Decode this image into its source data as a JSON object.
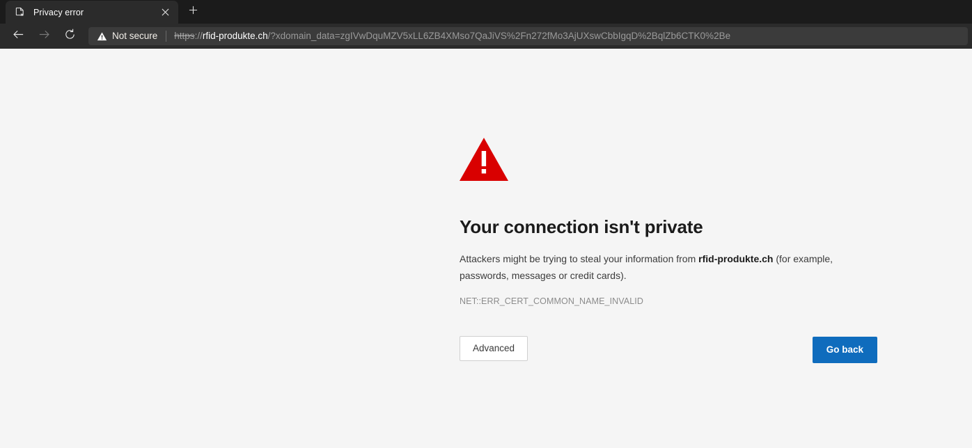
{
  "window": {
    "title": "Privacy error"
  },
  "tabstrip": {
    "tab": {
      "title": "Privacy error",
      "favicon_icon": "broken-page-icon",
      "close_icon": "close-icon"
    },
    "new_tab": {
      "icon": "plus-icon",
      "label": "New tab"
    }
  },
  "toolbar": {
    "back": {
      "icon": "arrow-left-icon",
      "label": "Back",
      "enabled": true
    },
    "forward": {
      "icon": "arrow-right-icon",
      "label": "Forward",
      "enabled": false
    },
    "reload": {
      "icon": "reload-icon",
      "label": "Refresh",
      "enabled": true
    },
    "address": {
      "security_icon": "warning-triangle-icon",
      "security_label": "Not secure",
      "url_scheme": "https",
      "url_scheme_separator": "://",
      "url_host": "rfid-produkte.ch",
      "url_path": "/?xdomain_data=zgIVwDquMZV5xLL6ZB4XMso7QaJiVS%2Fn272fMo3AjUXswCbbIgqD%2BqlZb6CTK0%2Be",
      "full_url": "https://rfid-produkte.ch/?xdomain_data=zgIVwDquMZV5xLL6ZB4XMso7QaJiVS%2Fn272fMo3AjUXswCbbIgqD%2BqlZb6CTK0%2Be"
    }
  },
  "interstitial": {
    "icon": "red-warning-triangle-icon",
    "heading": "Your connection isn't private",
    "body_prefix": "Attackers might be trying to steal your information from ",
    "body_domain": "rfid-produkte.ch",
    "body_suffix": " (for example, passwords, messages or credit cards).",
    "error_code": "NET::ERR_CERT_COMMON_NAME_INVALID",
    "advanced_label": "Advanced",
    "goback_label": "Go back"
  },
  "colors": {
    "page_background": "#f5f5f5",
    "chrome_toolbar": "#2b2b2b",
    "chrome_tabstrip": "#1b1b1b",
    "address_field": "#3b3b3b",
    "warning_red": "#d90000",
    "primary_blue": "#0f6cbd",
    "heading_text": "#1b1b1b",
    "body_text": "#3b3b3b",
    "error_code_text": "#8b8b8b"
  }
}
